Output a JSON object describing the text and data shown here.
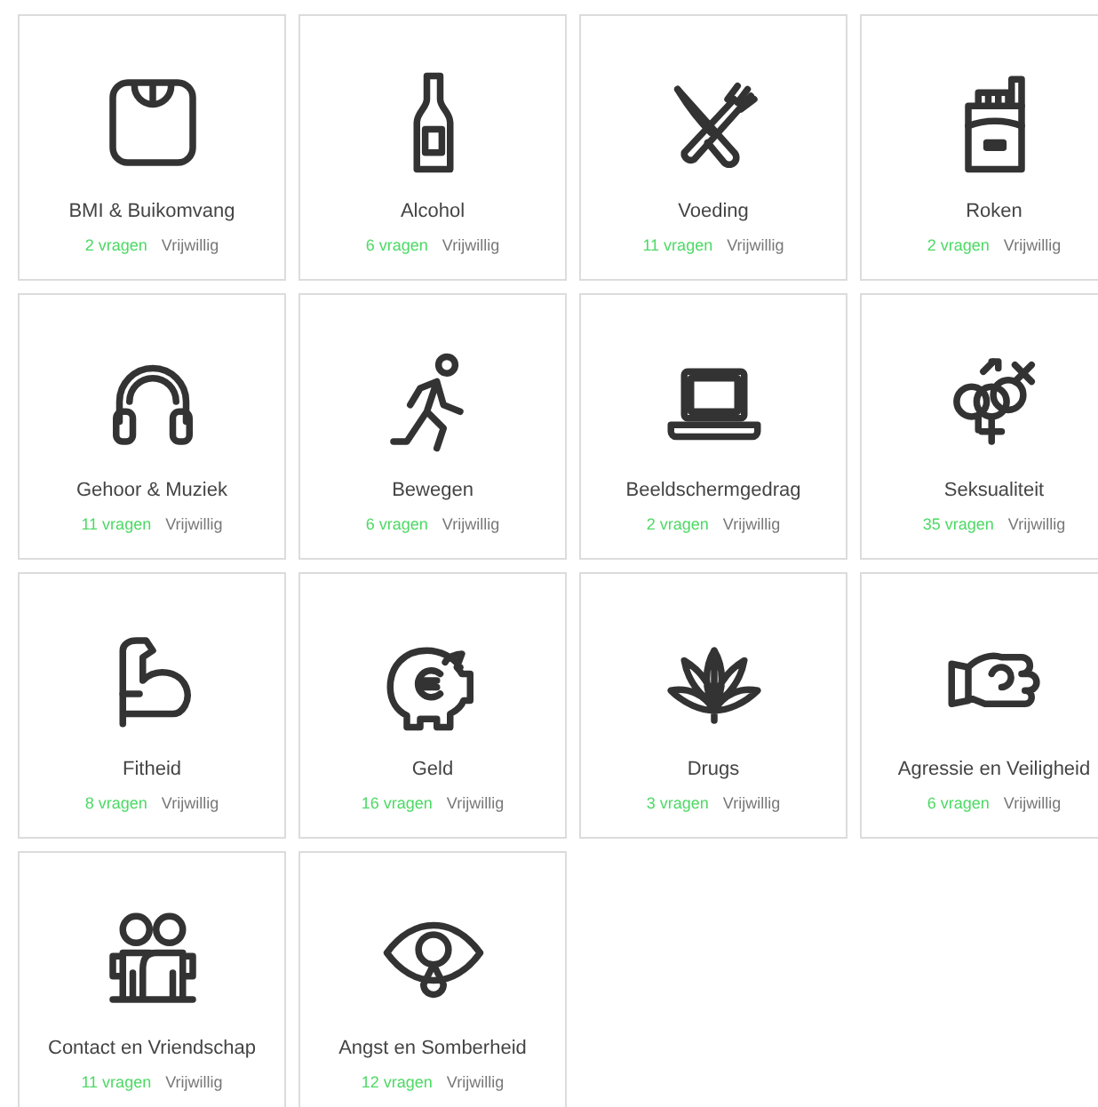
{
  "topics": [
    {
      "title": "BMI & Buikomvang",
      "count": "2 vragen",
      "tag": "Vrijwillig"
    },
    {
      "title": "Alcohol",
      "count": "6 vragen",
      "tag": "Vrijwillig"
    },
    {
      "title": "Voeding",
      "count": "11 vragen",
      "tag": "Vrijwillig"
    },
    {
      "title": "Roken",
      "count": "2 vragen",
      "tag": "Vrijwillig"
    },
    {
      "title": "Gehoor & Muziek",
      "count": "11 vragen",
      "tag": "Vrijwillig"
    },
    {
      "title": "Bewegen",
      "count": "6 vragen",
      "tag": "Vrijwillig"
    },
    {
      "title": "Beeldschermgedrag",
      "count": "2 vragen",
      "tag": "Vrijwillig"
    },
    {
      "title": "Seksualiteit",
      "count": "35 vragen",
      "tag": "Vrijwillig"
    },
    {
      "title": "Fitheid",
      "count": "8 vragen",
      "tag": "Vrijwillig"
    },
    {
      "title": "Geld",
      "count": "16 vragen",
      "tag": "Vrijwillig"
    },
    {
      "title": "Drugs",
      "count": "3 vragen",
      "tag": "Vrijwillig"
    },
    {
      "title": "Agressie en Veiligheid",
      "count": "6 vragen",
      "tag": "Vrijwillig"
    },
    {
      "title": "Contact en Vriendschap",
      "count": "11 vragen",
      "tag": "Vrijwillig"
    },
    {
      "title": "Angst en Somberheid",
      "count": "12 vragen",
      "tag": "Vrijwillig"
    }
  ]
}
